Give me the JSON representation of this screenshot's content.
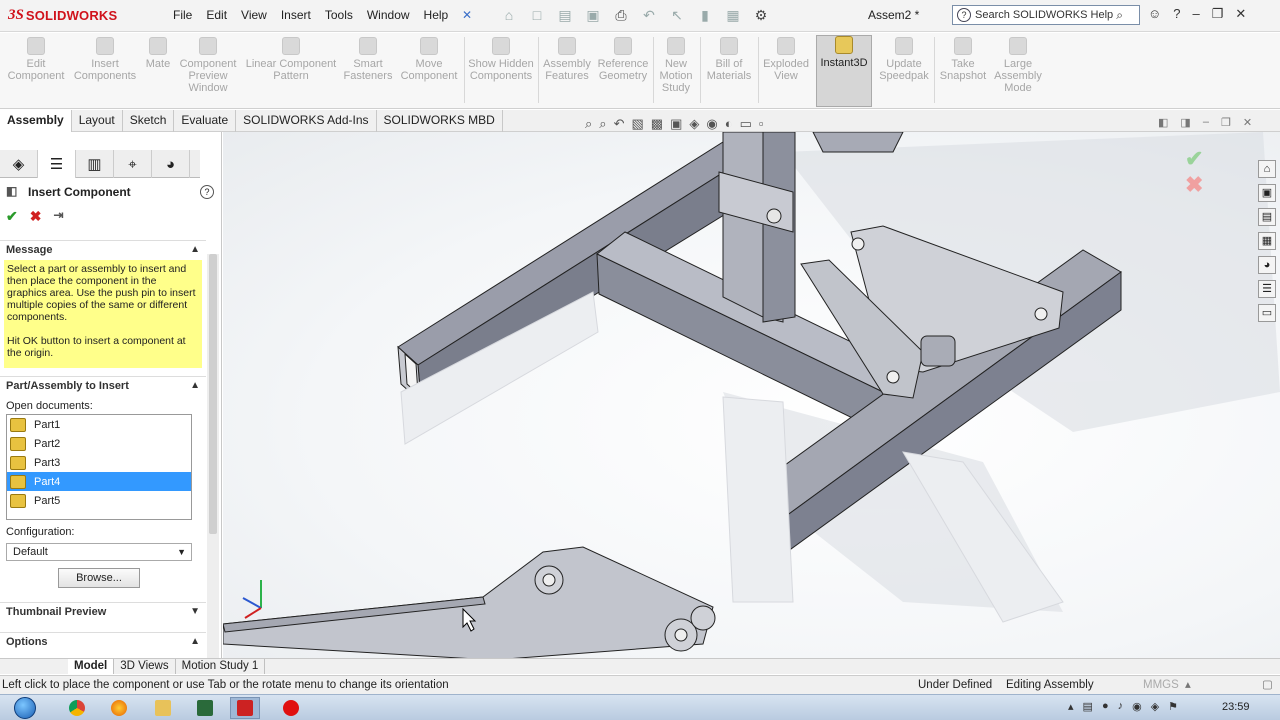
{
  "app": {
    "logo_ds": "3S",
    "logo_text": "SOLIDWORKS",
    "doc_title": "Assem2 *"
  },
  "menus": [
    "File",
    "Edit",
    "View",
    "Insert",
    "Tools",
    "Window",
    "Help"
  ],
  "search": {
    "text": "Search SOLIDWORKS Help",
    "qmark": "?"
  },
  "commands": [
    {
      "label": "Edit Component"
    },
    {
      "label": "Insert Components"
    },
    {
      "label": "Mate"
    },
    {
      "label": "Component Preview Window"
    },
    {
      "label": "Linear Component Pattern"
    },
    {
      "label": "Smart Fasteners"
    },
    {
      "label": "Move Component"
    },
    {
      "label": "Show Hidden Components"
    },
    {
      "label": "Assembly Features"
    },
    {
      "label": "Reference Geometry"
    },
    {
      "label": "New Motion Study"
    },
    {
      "label": "Bill of Materials"
    },
    {
      "label": "Exploded View"
    },
    {
      "label": "Instant3D"
    },
    {
      "label": "Update Speedpak"
    },
    {
      "label": "Take Snapshot"
    },
    {
      "label": "Large Assembly Mode"
    }
  ],
  "tabs": [
    "Assembly",
    "Layout",
    "Sketch",
    "Evaluate",
    "SOLIDWORKS Add-Ins",
    "SOLIDWORKS MBD"
  ],
  "pm": {
    "title": "Insert Component",
    "help": "?",
    "message_header": "Message",
    "message_1": "Select a part or assembly to insert and then place the component in the graphics area. Use the push pin to insert multiple copies of the same or different components.",
    "message_2": "Hit OK button to insert a component at the origin.",
    "part_header": "Part/Assembly to Insert",
    "open_docs_label": "Open documents:",
    "docs": [
      "Part1",
      "Part2",
      "Part3",
      "Part4",
      "Part5"
    ],
    "selected_doc": "Part4",
    "config_label": "Configuration:",
    "config_value": "Default",
    "browse": "Browse...",
    "thumb_header": "Thumbnail Preview",
    "options_header": "Options"
  },
  "model_tabs": [
    "Model",
    "3D Views",
    "Motion Study 1"
  ],
  "status": {
    "message": "Left click to place the component or use Tab or the rotate menu to change its orientation",
    "state": "Under Defined",
    "mode": "Editing Assembly",
    "units": "MMGS"
  },
  "clock": "23:59",
  "colors": {
    "accent": "#3399ff",
    "message_bg": "#ffff8a",
    "brand": "#d0121b"
  }
}
